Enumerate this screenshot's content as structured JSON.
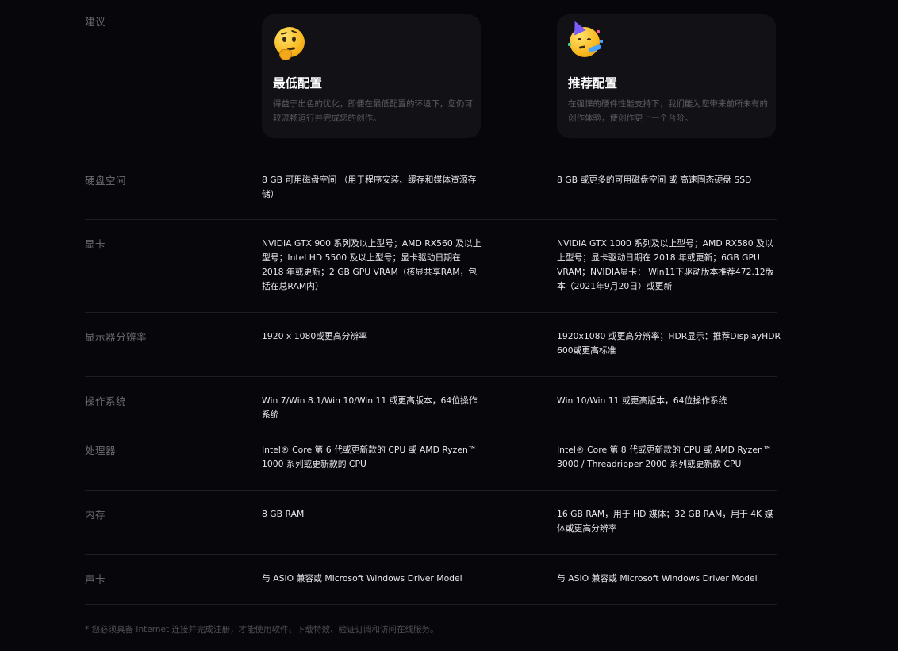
{
  "header": {
    "label": "建议"
  },
  "cards": {
    "min": {
      "emoji": "thinking-face",
      "title": "最低配置",
      "desc": "得益于出色的优化，即便在最低配置的环境下，您仍可较流畅运行并完成您的创作。"
    },
    "rec": {
      "emoji": "partying-face",
      "title": "推荐配置",
      "desc": "在强悍的硬件性能支持下，我们能为您带来前所未有的创作体验，使创作更上一个台阶。"
    }
  },
  "specs": [
    {
      "label": "硬盘空间",
      "min": "8 GB 可用磁盘空间 （用于程序安装、缓存和媒体资源存储）",
      "rec": "8 GB 或更多的可用磁盘空间 或 高速固态硬盘 SSD"
    },
    {
      "label": "显卡",
      "min": "NVIDIA GTX 900 系列及以上型号；AMD RX560 及以上型号；Intel HD 5500 及以上型号；显卡驱动日期在 2018 年或更新；2 GB GPU VRAM（核显共享RAM，包括在总RAM内）",
      "rec": "NVIDIA GTX 1000 系列及以上型号；AMD RX580 及以上型号；显卡驱动日期在 2018 年或更新；6GB GPU VRAM；NVIDIA显卡： Win11下驱动版本推荐472.12版本（2021年9月20日）或更新"
    },
    {
      "label": "显示器分辨率",
      "min": "1920 x 1080或更高分辨率",
      "rec": "1920x1080 或更高分辨率；HDR显示：推荐DisplayHDR 600或更高标准"
    },
    {
      "label": "操作系统",
      "min": "Win 7/Win 8.1/Win 10/Win 11 或更高版本，64位操作系统",
      "rec": "Win 10/Win 11 或更高版本，64位操作系统"
    },
    {
      "label": "处理器",
      "min": "Intel® Core 第 6 代或更新款的 CPU 或 AMD Ryzen™ 1000 系列或更新款的 CPU",
      "rec": "Intel® Core 第 8 代或更新款的 CPU 或 AMD Ryzen™ 3000 / Threadripper 2000 系列或更新款 CPU"
    },
    {
      "label": "内存",
      "min": "8 GB RAM",
      "rec": "16 GB RAM，用于 HD 媒体；32 GB RAM，用于 4K 媒体或更高分辨率"
    },
    {
      "label": "声卡",
      "min": "与 ASIO 兼容或 Microsoft Windows Driver Model",
      "rec": "与 ASIO 兼容或 Microsoft Windows Driver Model"
    }
  ],
  "footnote": "* 您必须具备 Internet 连接并完成注册，才能使用软件、下载特效、验证订阅和访问在线服务。",
  "colors": {
    "background": "#07070b",
    "card": "#111116",
    "label": "#6c6c72",
    "value": "#e8e8ec",
    "divider": "#1d1d22"
  }
}
